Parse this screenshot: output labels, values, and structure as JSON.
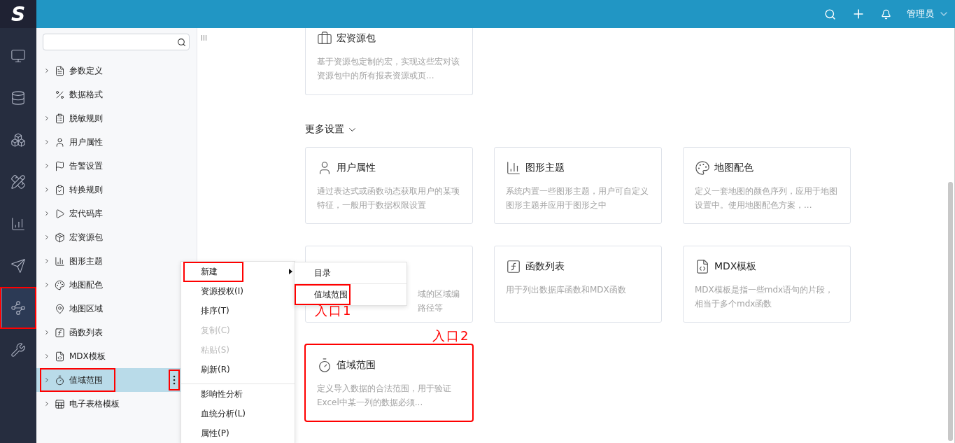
{
  "logo": {
    "text": "S"
  },
  "header": {
    "user": "管理员"
  },
  "rail": {
    "items": [
      {
        "selected": false,
        "annotated": false
      },
      {
        "selected": false,
        "annotated": false
      },
      {
        "selected": false,
        "annotated": false
      },
      {
        "selected": false,
        "annotated": false
      },
      {
        "selected": false,
        "annotated": false
      },
      {
        "selected": false,
        "annotated": false
      },
      {
        "selected": true,
        "annotated": true
      },
      {
        "selected": false,
        "annotated": false
      }
    ]
  },
  "tree": {
    "items": [
      {
        "label": "参数定义",
        "has_children": true,
        "selected": false,
        "annotated": false
      },
      {
        "label": "数据格式",
        "has_children": false,
        "selected": false,
        "annotated": false
      },
      {
        "label": "脱敏规则",
        "has_children": true,
        "selected": false,
        "annotated": false
      },
      {
        "label": "用户属性",
        "has_children": true,
        "selected": false,
        "annotated": false
      },
      {
        "label": "告警设置",
        "has_children": true,
        "selected": false,
        "annotated": false
      },
      {
        "label": "转换规则",
        "has_children": true,
        "selected": false,
        "annotated": false
      },
      {
        "label": "宏代码库",
        "has_children": true,
        "selected": false,
        "annotated": false
      },
      {
        "label": "宏资源包",
        "has_children": true,
        "selected": false,
        "annotated": false
      },
      {
        "label": "图形主题",
        "has_children": true,
        "selected": false,
        "annotated": false
      },
      {
        "label": "地图配色",
        "has_children": true,
        "selected": false,
        "annotated": false
      },
      {
        "label": "地图区域",
        "has_children": false,
        "selected": false,
        "annotated": false
      },
      {
        "label": "函数列表",
        "has_children": true,
        "selected": false,
        "annotated": false
      },
      {
        "label": "MDX模板",
        "has_children": true,
        "selected": false,
        "annotated": false
      },
      {
        "label": "值域范围",
        "has_children": true,
        "selected": true,
        "annotated": true
      },
      {
        "label": "电子表格模板",
        "has_children": true,
        "selected": false,
        "annotated": false
      }
    ],
    "more_button": {
      "annotated": true
    }
  },
  "context_menu": {
    "items": [
      {
        "label": "新建",
        "submenu": true,
        "disabled": false,
        "divider_before": false,
        "annotated": true
      },
      {
        "label": "资源授权(I)",
        "submenu": false,
        "disabled": false,
        "divider_before": false,
        "annotated": false
      },
      {
        "label": "排序(T)",
        "submenu": false,
        "disabled": false,
        "divider_before": false,
        "annotated": false
      },
      {
        "label": "复制(C)",
        "submenu": false,
        "disabled": true,
        "divider_before": false,
        "annotated": false
      },
      {
        "label": "粘贴(S)",
        "submenu": false,
        "disabled": true,
        "divider_before": false,
        "annotated": false
      },
      {
        "label": "刷新(R)",
        "submenu": false,
        "disabled": false,
        "divider_before": false,
        "annotated": false
      },
      {
        "label": "影响性分析",
        "submenu": false,
        "disabled": false,
        "divider_before": true,
        "annotated": false
      },
      {
        "label": "血统分析(L)",
        "submenu": false,
        "disabled": false,
        "divider_before": false,
        "annotated": false
      },
      {
        "label": "属性(P)",
        "submenu": false,
        "disabled": false,
        "divider_before": false,
        "annotated": false
      }
    ]
  },
  "submenu": {
    "items": [
      {
        "label": "目录",
        "annotated": false
      },
      {
        "label": "值域范围",
        "annotated": true
      }
    ]
  },
  "top_cards": [
    {
      "kind": "full",
      "title": "宏资源包",
      "description": "基于资源包定制的宏，实现这些宏对该资源包中的所有报表资源或页...",
      "annotated": false
    }
  ],
  "section": {
    "title": "更多设置",
    "expanded": true
  },
  "cards": [
    {
      "kind": "full",
      "title": "用户属性",
      "description": "通过表达式或函数动态获取用户的某项特征，一般用于数据权限设置",
      "annotated": false
    },
    {
      "kind": "full",
      "title": "图形主题",
      "description": "系统内置一些图形主题，用户可自定义图形主题并应用于图形之中",
      "annotated": false
    },
    {
      "kind": "full",
      "title": "地图配色",
      "description": "定义一套地图的颜色序列，应用于地图设置中。使用地图配色方案，...",
      "annotated": false
    },
    {
      "kind": "partial",
      "fragments": [
        "域的区域编",
        "路径等"
      ],
      "annotated": false
    },
    {
      "kind": "full",
      "title": "函数列表",
      "description": "用于列出数据库函数和MDX函数",
      "annotated": false
    },
    {
      "kind": "full",
      "title": "MDX模板",
      "description": "MDX模板是指一些mdx语句的片段，相当于多个mdx函数",
      "annotated": false
    },
    {
      "kind": "full",
      "title": "值域范围",
      "description": "定义导入数据的合法范围，用于验证Excel中某一列的数据必须...",
      "annotated": true
    }
  ],
  "annotations": [
    {
      "text": "入口1"
    },
    {
      "text": "入口2"
    }
  ]
}
